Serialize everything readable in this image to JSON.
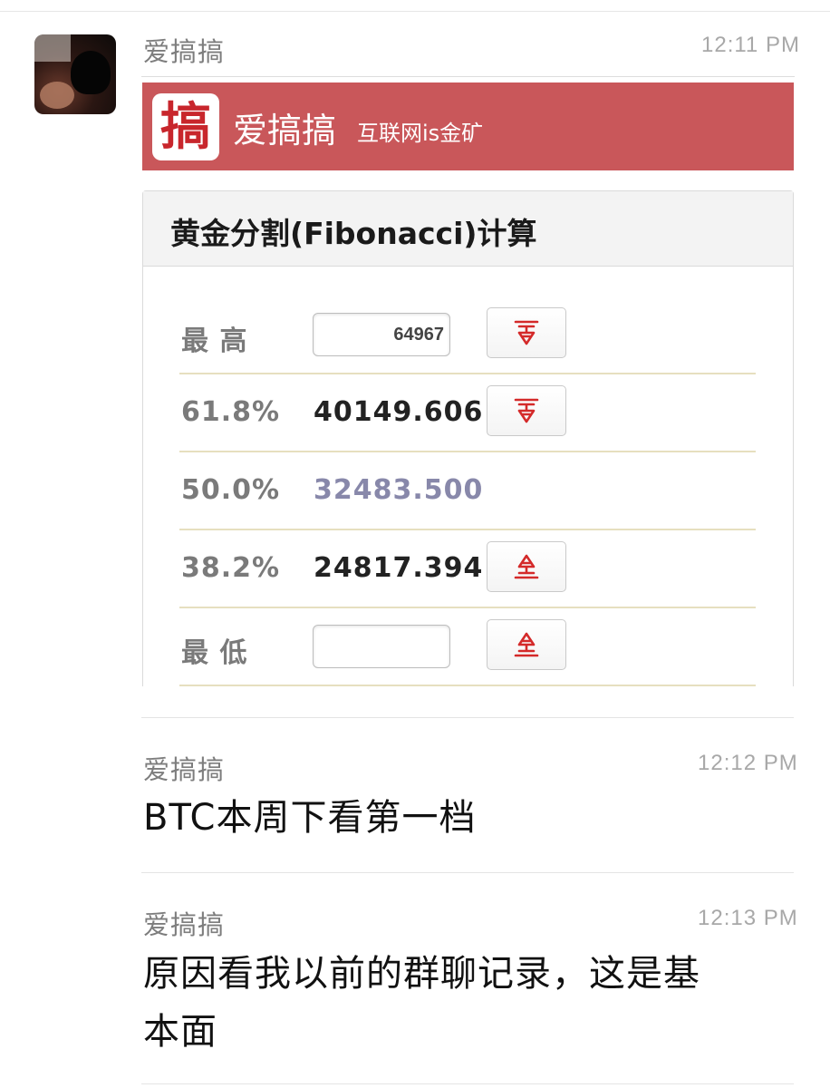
{
  "messages": [
    {
      "sender": "爱搞搞",
      "time": "12:11 PM",
      "card": {
        "logo_char": "搞",
        "brand_name": "爱搞搞",
        "slogan": "互联网is金矿",
        "panel_title": "黄金分割(Fibonacci)计算",
        "rows": {
          "high": {
            "label": "最 高",
            "input_value": "64967"
          },
          "r618": {
            "label": "61.8%",
            "value": "40149.606"
          },
          "r500": {
            "label": "50.0%",
            "value": "32483.500"
          },
          "r382": {
            "label": "38.2%",
            "value": "24817.394"
          },
          "low": {
            "label": "最 低",
            "input_value": ""
          }
        },
        "icons": {
          "down": "down-arrow-icon",
          "up": "up-arrow-icon"
        },
        "colors": {
          "brand": "#c9575a",
          "arrow": "#d42a2a",
          "mid_value": "#8888aa"
        }
      }
    },
    {
      "sender": "爱搞搞",
      "time": "12:12 PM",
      "text": "BTC本周下看第一档"
    },
    {
      "sender": "爱搞搞",
      "time": "12:13 PM",
      "text_line1": "原因看我以前的群聊记录，这是基",
      "text_line2": "本面"
    }
  ]
}
